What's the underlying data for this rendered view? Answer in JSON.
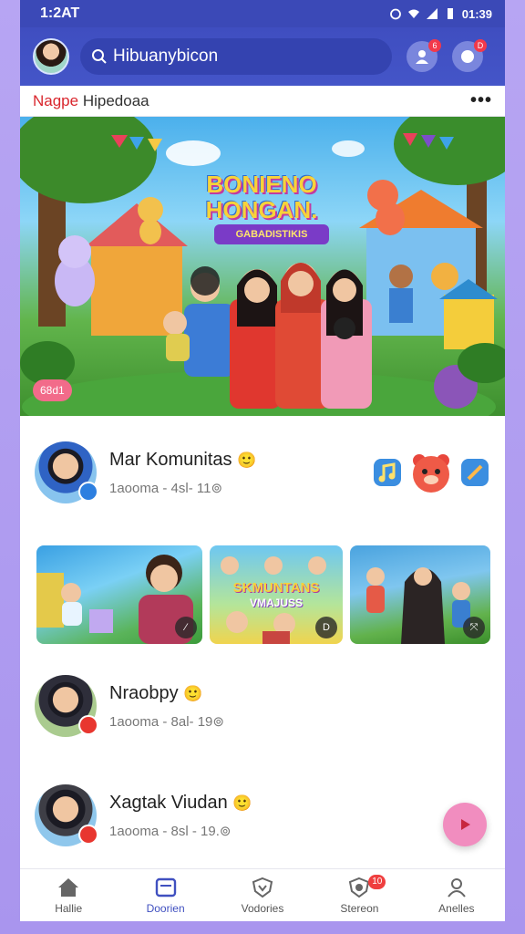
{
  "status_bar": {
    "time": "1:2AT",
    "right_text": "01:39"
  },
  "header": {
    "search_text": "Hibuanybicon",
    "notif_badge_1": "6",
    "notif_badge_2": "D"
  },
  "title_bar": {
    "red_text": "Nagpe",
    "dark_text": "Hipedoaa",
    "more": "•••"
  },
  "hero": {
    "title_line1": "BONIENO",
    "title_line2": "HONGAN.",
    "subtitle": "GABADISTIKIS",
    "badge": "68d1"
  },
  "feed": [
    {
      "name": "Mar Komunitas",
      "emoji": "🙂",
      "meta": "1aooma - 4sl- 11⊚"
    },
    {
      "name": "Nraobpy",
      "emoji": "🙂",
      "meta": "1aooma - 8al- 19⊚"
    },
    {
      "name": "Xagtak Viudan",
      "emoji": "🙂",
      "meta": "1aooma - 8sl - 19.⊚"
    }
  ],
  "tiles": [
    {
      "play": "⁄"
    },
    {
      "title": "SKMUNTANS",
      "sub": "VMAJUSS",
      "play": "D"
    },
    {
      "play": "⤧"
    }
  ],
  "nav": [
    {
      "label": "Hallie",
      "icon": "home-icon"
    },
    {
      "label": "Doorien",
      "icon": "calendar-icon"
    },
    {
      "label": "Vodories",
      "icon": "shield-heart-icon"
    },
    {
      "label": "Stereon",
      "icon": "bell-icon",
      "badge": "10"
    },
    {
      "label": "Anelles",
      "icon": "user-icon"
    }
  ],
  "colors": {
    "header": "#3f4ec0",
    "accent_red": "#d9262d",
    "fab": "#f18dbf",
    "active_nav": "#4050c0"
  }
}
